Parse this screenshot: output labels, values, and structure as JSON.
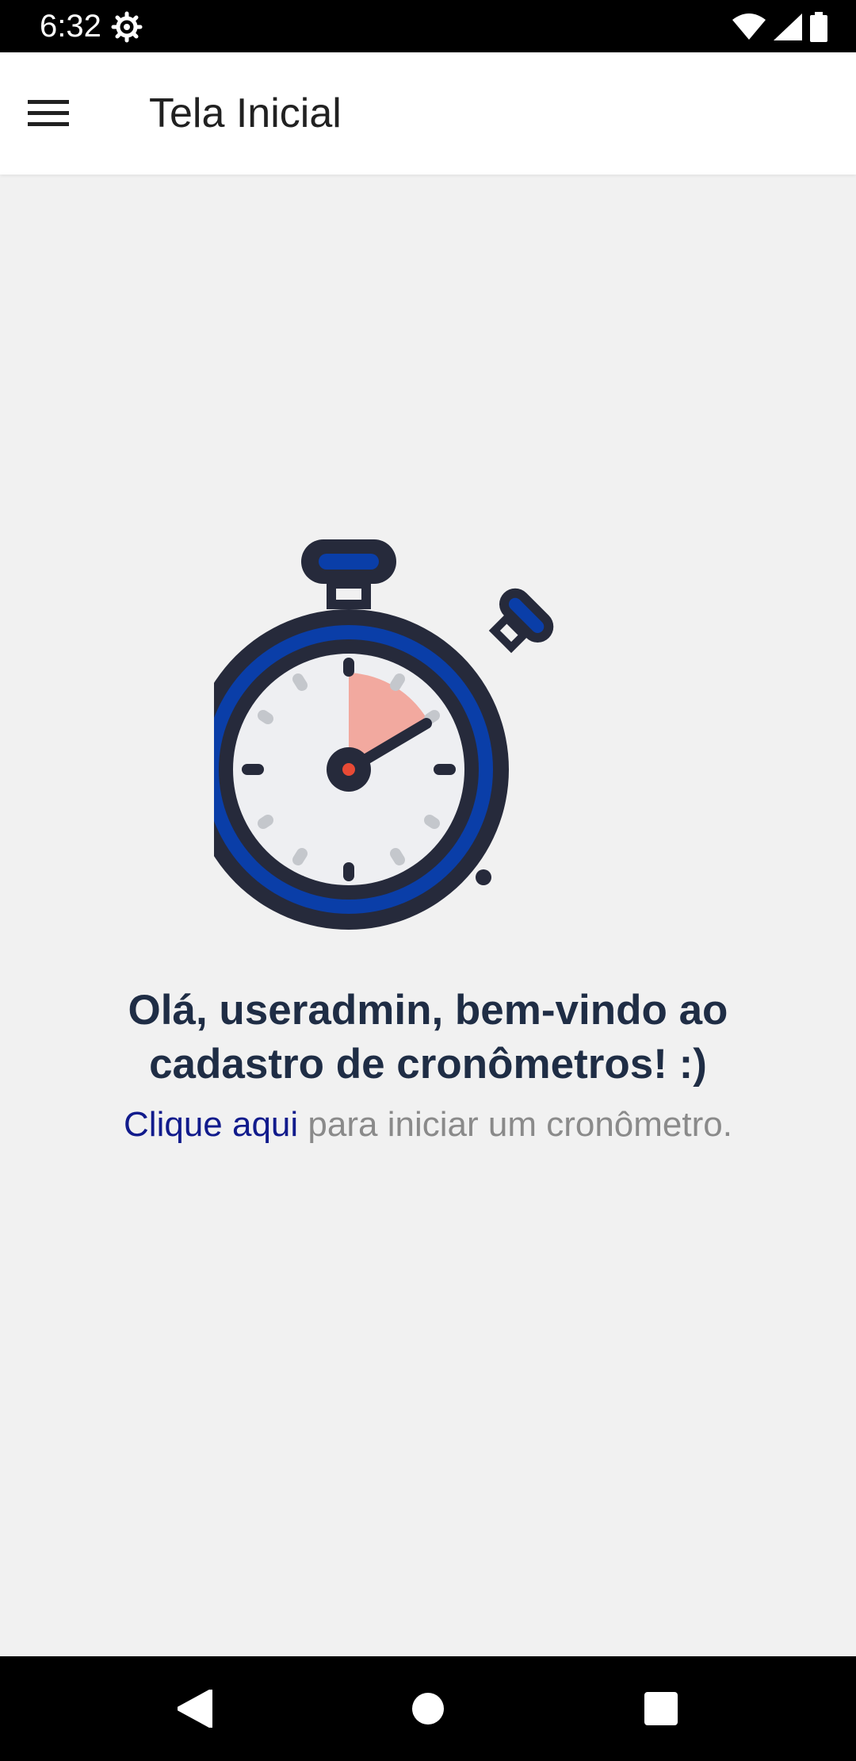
{
  "status_bar": {
    "time": "6:32",
    "icons": [
      "settings-gear-icon",
      "wifi-icon",
      "signal-icon",
      "battery-icon"
    ]
  },
  "app_bar": {
    "title": "Tela Inicial",
    "menu_icon": "hamburger-menu-icon"
  },
  "main": {
    "illustration": "stopwatch-illustration",
    "welcome_message": "Olá, useradmin, bem-vindo ao cadastro de cronômetros! :)",
    "link_text": "Clique aqui",
    "link_suffix": " para iniciar um cronômetro."
  },
  "nav_bar": {
    "buttons": [
      "back-icon",
      "home-icon",
      "recents-icon"
    ]
  },
  "colors": {
    "accent_blue": "#0a3ea8",
    "dark_navy": "#262a3b",
    "link_blue": "#111b8c",
    "highlight_salmon": "#f2a99f",
    "dial_gray": "#c4c7cc"
  }
}
